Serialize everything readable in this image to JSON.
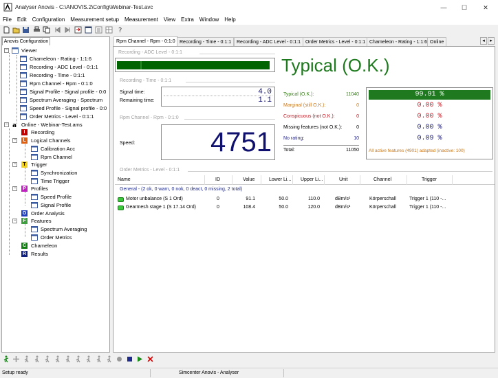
{
  "window": {
    "title": "Analyser Anovis - C:\\ANOVIS.2\\Config\\Webinar-Test.avc",
    "minimize": "—",
    "maximize": "☐",
    "close": "✕"
  },
  "menu": [
    "File",
    "Edit",
    "Configuration",
    "Measurement setup",
    "Measurement",
    "View",
    "Extra",
    "Window",
    "Help"
  ],
  "left_panel": {
    "tab": "Anovis Configuration",
    "tree": {
      "viewer": "Viewer",
      "viewer_items": [
        "Chameleon - Rating - 1:1:6",
        "Recording - ADC Level - 0:1:1",
        "Recording - Time - 0:1:1",
        "Rpm Channel - Rpm - 0:1:0",
        "Signal Profile - Signal profile - 0:0",
        "Spectrum Averaging - Spectrum",
        "Speed Profile - Signal profile - 0:0",
        "Order Metrics - Level - 0:1:1"
      ],
      "online": "Online - Webinar-Test.ams",
      "recording": "Recording",
      "logical_channels": "Logical Channels",
      "calibration_acc": "Calibration Acc",
      "rpm_channel": "Rpm Channel",
      "trigger": "Trigger",
      "synchronization": "Synchronization",
      "time_trigger": "Time Trigger",
      "profiles": "Profiles",
      "speed_profile": "Speed Profile",
      "signal_profile": "Signal Profile",
      "order_analysis": "Order Analysis",
      "features": "Features",
      "spectrum_averaging": "Spectrum Averaging",
      "order_metrics": "Order Metrics",
      "chameleon": "Chameleon",
      "results": "Results",
      "letters": {
        "recording": "I",
        "logical": "L",
        "trigger": "T",
        "profiles": "P",
        "order": "O",
        "features": "F",
        "chameleon": "C",
        "results": "R"
      }
    }
  },
  "tabs": [
    "Rpm Channel - Rpm - 0:1:0",
    "Recording - Time - 0:1:1",
    "Recording - ADC Level - 0:1:1",
    "Order Metrics - Level - 0:1:1",
    "Chameleon - Rating - 1:1:6",
    "Online"
  ],
  "tab_arrows": {
    "left": "◂",
    "right": "▸"
  },
  "adc": {
    "label": "Recording - ADC Level - 0:1:1",
    "level_fraction": 0.98
  },
  "time": {
    "label": "Recording - Time - 0:1:1",
    "signal_time_label": "Signal time:",
    "signal_time_value": "4.0",
    "remaining_time_label": "Remaining time:",
    "remaining_time_value": "1.1"
  },
  "rpm": {
    "label": "Rpm Channel - Rpm - 0:1:0",
    "speed_label": "Speed:",
    "speed_value": "4751"
  },
  "rating": {
    "headline": "Typical (O.K.)",
    "rows": [
      {
        "label": "Typical (O.K.):",
        "count": "11040",
        "percent": "99.91 %",
        "color": "#3a7d1e"
      },
      {
        "label": "Marginal (still O.K.):",
        "count": "0",
        "percent": "0.00 %",
        "color": "#c8781e"
      },
      {
        "label": "Conspicuous (not O.K.):",
        "count": "0",
        "percent": "0.00 %",
        "color": "#c0141e"
      },
      {
        "label": "Missing features (not O.K.):",
        "count": "0",
        "percent": "0.00 %",
        "color": "#000000"
      },
      {
        "label": "No rating:",
        "count": "10",
        "percent": "0.09 %",
        "color": "#1e1e8c"
      }
    ],
    "total_label": "Total:",
    "total_value": "11050",
    "adapted_note": "All active features (4901) adapted (inactive: 100)"
  },
  "order_metrics": {
    "label": "Order Metrics - Level - 0:1:1",
    "columns": [
      "Name",
      "ID",
      "Value",
      "Lower Li...",
      "Upper Li...",
      "Unit",
      "Channel",
      "Trigger"
    ],
    "group": "General - (2 ok, 0 warn, 0 nok, 0 deact, 0 missing, 2 total)",
    "rows": [
      {
        "name": "Motor unbalance (S 1 Ord)",
        "id": "0",
        "value": "91.1",
        "lower": "50.0",
        "upper": "110.0",
        "unit": "dBm/s²",
        "channel": "Körperschall",
        "trigger": "Trigger 1 (110 -..."
      },
      {
        "name": "Gearmesh stage 1 (S 17.14 Ord)",
        "id": "0",
        "value": "108.4",
        "lower": "50.0",
        "upper": "120.0",
        "unit": "dBm/s²",
        "channel": "Körperschall",
        "trigger": "Trigger 1 (110 -..."
      }
    ]
  },
  "status": {
    "left": "Setup ready",
    "center": "Simcenter Anovis - Analyser"
  },
  "colors": {
    "ok_green": "#1f7a1f",
    "bar_green": "#006400",
    "speed_blue": "#10106e"
  }
}
